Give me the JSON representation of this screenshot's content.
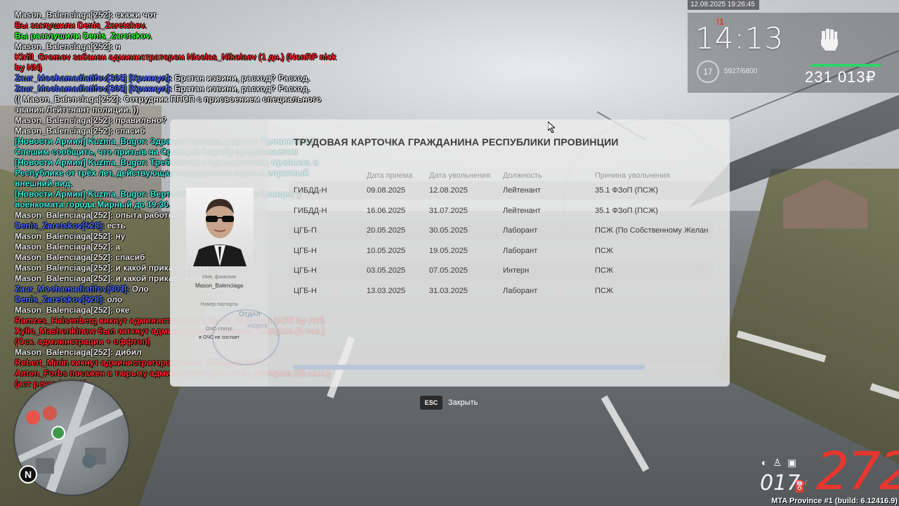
{
  "hud": {
    "date_time": "12.08.2025 19:26:45",
    "clock": "14:13",
    "badge": "!1",
    "level": "17",
    "experience": "5927/6800",
    "money": "231 013₽"
  },
  "chat": [
    {
      "text": "Mason_Balenciaga[252]: скажи чот",
      "color": "#e6e6e6"
    },
    {
      "text": "Вы заглушили Denis_Zaretskov.",
      "color": "#ff2a2a"
    },
    {
      "text": "Вы разглушили Denis_Zaretskov.",
      "color": "#3cff3c"
    },
    {
      "text": "Mason_Balenciaga[252]: н",
      "color": "#e6e6e6"
    },
    {
      "text": "Kirill_Gromov забанен администратором Nicolas_Nikolaev (1 дн.) (NonRP nick by NN)",
      "color": "#ff2a2a"
    },
    {
      "text": "Zaur_Moohamadiatifov[303] [Крикнул]: Братан извини, расход? Расход.",
      "color": "#e6e6e6",
      "prefix": "Zaur_Moohamadiatifov[303] [Крикнул]:",
      "prefix_color": "#4b6bff"
    },
    {
      "text": "Zaur_Moohamadiatifov[303] [Крикнул]: Братан извини, расход? Расход.",
      "color": "#e6e6e6",
      "prefix": "Zaur_Moohamadiatifov[303] [Крикнул]:",
      "prefix_color": "#4b6bff"
    },
    {
      "text": "(( Mason_Balenciaga[252]: Сотрудник ППСП с присвоением специального звания Лейтенант полиции. ))",
      "color": "#e6e6e6"
    },
    {
      "text": "Mason_Balenciaga[252]: правильно?",
      "color": "#e6e6e6"
    },
    {
      "text": "Mason_Balenciaga[252]: спасиб",
      "color": "#e6e6e6"
    },
    {
      "text": "[Новости Армия] Kuzma_Bugor: Здравия желаем, дорогие Провинчане! Спешим сообщить, что призыв на Срочную Службу продолжается!",
      "color": "#3ef0e0"
    },
    {
      "text": "[Новости Армия] Kuzma_Bugor: Требования к призывникам: прописка в Республике от трёх лет, действующая медицинская карта и опрятный внешний вид.",
      "color": "#3ef0e0"
    },
    {
      "text": "[Новости Армия] Kuzma_Bugor: Вертолёты ожидают новобранцев у военкомата города Мирный до 19:30.",
      "color": "#3ef0e0"
    },
    {
      "text": "Mason_Balenciaga[252]: опыта работы в мвд же нету?",
      "color": "#e6e6e6"
    },
    {
      "text": "Denis_Zaretskov[528]: есть",
      "color": "#e6e6e6",
      "prefix": "Denis_Zaretskov[528]:",
      "prefix_color": "#4b6bff"
    },
    {
      "text": "Mason_Balenciaga[252]: ну",
      "color": "#e6e6e6"
    },
    {
      "text": "Mason_Balenciaga[252]: а",
      "color": "#e6e6e6"
    },
    {
      "text": "Mason_Balenciaga[252]: спасиб",
      "color": "#e6e6e6"
    },
    {
      "text": "Mason_Balenciaga[252]: и какой приказ сказате ?",
      "color": "#e6e6e6"
    },
    {
      "text": "Mason_Balenciaga[252]: и какой приказ сказате",
      "color": "#e6e6e6"
    },
    {
      "text": "Zaur_Moohamadiatifov[303]: Оло",
      "color": "#e6e6e6",
      "prefix": "Zaur_Moohamadiatifov[303]:",
      "prefix_color": "#4b6bff"
    },
    {
      "text": "Denis_Zaretskov[528]: оло",
      "color": "#e6e6e6",
      "prefix": "Denis_Zaretskov[528]:",
      "prefix_color": "#4b6bff"
    },
    {
      "text": "Mason_Balenciaga[252]: оке",
      "color": "#e6e6e6"
    },
    {
      "text": "Ramzes_Haisenberg кикнут администратором Kevin_Ellington (AFK by AW)",
      "color": "#ff2a2a"
    },
    {
      "text": "Xylio_Mashonkinow был заткнут администратором Kevin_Ellington (3 час.) (Оск. администрации + оффтоп)",
      "color": "#ff2a2a"
    },
    {
      "text": "Mason_Balenciaga[252]: дибил",
      "color": "#e6e6e6"
    },
    {
      "text": "Robert_Minin кикнут администратором Kevin_Ellington (AFK)",
      "color": "#ff2a2a"
    },
    {
      "text": "Anton_Forbs посажен в тюрьму администратором Kevin_Ellington (30 мин.) (аст речка by AW)",
      "color": "#ff2a2a"
    }
  ],
  "modal": {
    "title": "ТРУДОВАЯ КАРТОЧКА ГРАЖДАНИНА РЕСПУБЛИКИ ПРОВИНЦИИ",
    "name_label": "Имя, фамилия",
    "name_value": "Mason_Balenciaga",
    "passport_label": "Номер паспорта",
    "och_label": "ОЧС-статус",
    "och_value": "в ОЧС не состоит",
    "stamp_text": "Отдел",
    "stamp_text2": "кадров",
    "columns": [
      "Дата приема",
      "Дата увольнения",
      "Должность",
      "Причина увольнения"
    ],
    "rows": [
      {
        "org": "ГИБДД-Н",
        "start": "09.08.2025",
        "end": "12.08.2025",
        "position": "Лейтенант",
        "reason": "35.1 ФЗоП (ПСЖ)"
      },
      {
        "org": "ГИБДД-Н",
        "start": "16.06.2025",
        "end": "31.07.2025",
        "position": "Лейтенант",
        "reason": "35.1 ФЗоП (ПСЖ)"
      },
      {
        "org": "ЦГБ-П",
        "start": "20.05.2025",
        "end": "30.05.2025",
        "position": "Лаборант",
        "reason": "ПСЖ (По Собственному Желан"
      },
      {
        "org": "ЦГБ-Н",
        "start": "10.05.2025",
        "end": "19.05.2025",
        "position": "Лаборант",
        "reason": "ПСЖ"
      },
      {
        "org": "ЦГБ-Н",
        "start": "03.05.2025",
        "end": "07.05.2025",
        "position": "Интерн",
        "reason": "ПСЖ"
      },
      {
        "org": "ЦГБ-Н",
        "start": "13.03.2025",
        "end": "31.03.2025",
        "position": "Лаборант",
        "reason": "ПСЖ"
      }
    ],
    "scroll_fraction": 0.84
  },
  "close": {
    "key": "ESC",
    "label": "Закрыть"
  },
  "vehicle": {
    "speed": "272",
    "gear": "017"
  },
  "minimap": {
    "north": "N"
  },
  "build": "MTA Province #1 (build: 6.12416.9)",
  "icons": [
    "fist-icon",
    "fuel-icon",
    "headlight-icon",
    "seatbelt-icon",
    "engine-icon",
    "cursor-icon",
    "home-icon",
    "hospital-icon"
  ]
}
